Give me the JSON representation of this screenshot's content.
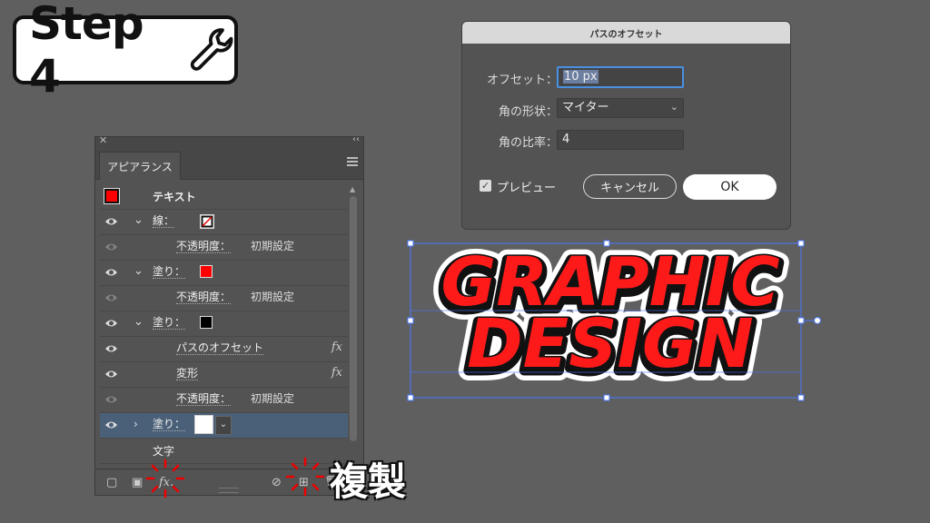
{
  "step_badge": {
    "label": "Step 4",
    "icon": "wrench-icon"
  },
  "appearance_panel": {
    "tab": "アピアランス",
    "rows": [
      {
        "type": "header",
        "label": "テキスト",
        "swatch": "#ff0000"
      },
      {
        "type": "stroke",
        "label": "線：",
        "swatch": "none-slash",
        "visible": true,
        "expanded": true
      },
      {
        "type": "attr",
        "label": "不透明度：",
        "value": "初期設定",
        "visible": false
      },
      {
        "type": "fill",
        "label": "塗り：",
        "swatch": "#ff0000",
        "visible": true,
        "expanded": true
      },
      {
        "type": "attr",
        "label": "不透明度：",
        "value": "初期設定",
        "visible": false
      },
      {
        "type": "fill",
        "label": "塗り：",
        "swatch": "#000000",
        "visible": true,
        "expanded": true
      },
      {
        "type": "effect",
        "label": "パスのオフセット",
        "fx": "fx",
        "visible": true
      },
      {
        "type": "effect",
        "label": "変形",
        "fx": "fx",
        "visible": true
      },
      {
        "type": "attr",
        "label": "不透明度：",
        "value": "初期設定",
        "visible": false
      },
      {
        "type": "fill-selected",
        "label": "塗り：",
        "swatch": "#ffffff",
        "visible": true,
        "expanded": false
      },
      {
        "type": "plain",
        "label": "文字"
      }
    ],
    "fx_label": "fx.",
    "duplicate_callout": "複製"
  },
  "offset_dialog": {
    "title": "パスのオフセット",
    "offset_label": "オフセット：",
    "offset_value": "10 px",
    "joins_label": "角の形状：",
    "joins_value": "マイター",
    "miter_label": "角の比率：",
    "miter_value": "4",
    "preview_label": "プレビュー",
    "preview_checked": true,
    "cancel_label": "キャンセル",
    "ok_label": "OK"
  },
  "artwork": {
    "line1": "GRAPHIC",
    "line2": "DESIGN",
    "fill_color": "#ff1a1a",
    "outline_color": "#111111",
    "offset_color": "#ffffff",
    "selection_color": "#4a78ff"
  }
}
